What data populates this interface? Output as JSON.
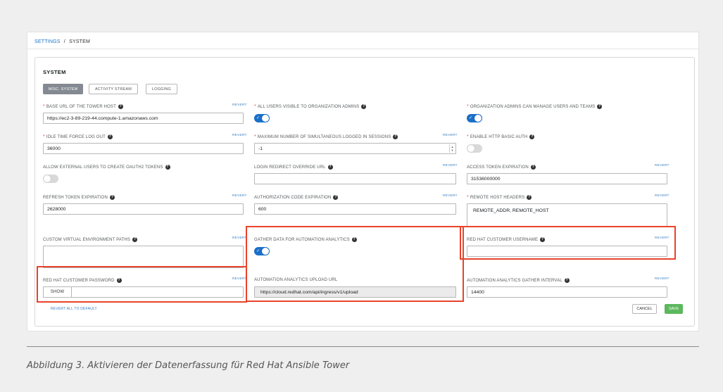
{
  "breadcrumb": {
    "parent": "SETTINGS",
    "separator": "/",
    "current": "SYSTEM"
  },
  "panel": {
    "title": "SYSTEM"
  },
  "tabs": [
    {
      "label": "MISC. SYSTEM",
      "active": true
    },
    {
      "label": "ACTIVITY STREAM",
      "active": false
    },
    {
      "label": "LOGGING",
      "active": false
    }
  ],
  "revert_label": "REVERT",
  "required_mark": "*",
  "help_glyph": "?",
  "fields": {
    "base_url": {
      "label": "BASE URL OF THE TOWER HOST",
      "value": "https://ec2-3-89-219-44.compute-1.amazonaws.com"
    },
    "users_visible": {
      "label": "ALL USERS VISIBLE TO ORGANIZATION ADMINS",
      "enabled": true
    },
    "org_admins_manage": {
      "label": "ORGANIZATION ADMINS CAN MANAGE USERS AND TEAMS",
      "enabled": true
    },
    "idle_logout": {
      "label": "IDLE TIME FORCE LOG OUT",
      "value": "36000"
    },
    "max_sessions": {
      "label": "MAXIMUM NUMBER OF SIMULTANEOUS LOGGED IN SESSIONS",
      "value": "-1"
    },
    "basic_auth": {
      "label": "ENABLE HTTP BASIC AUTH",
      "enabled": false
    },
    "oauth_tokens": {
      "label": "ALLOW EXTERNAL USERS TO CREATE OAUTH2 TOKENS",
      "enabled": false
    },
    "login_redirect": {
      "label": "LOGIN REDIRECT OVERRIDE URL",
      "value": ""
    },
    "access_token": {
      "label": "ACCESS TOKEN EXPIRATION",
      "value": "31536000000"
    },
    "refresh_token": {
      "label": "REFRESH TOKEN EXPIRATION",
      "value": "2628000"
    },
    "auth_code": {
      "label": "AUTHORIZATION CODE EXPIRATION",
      "value": "600"
    },
    "remote_host": {
      "label": "REMOTE HOST HEADERS",
      "value": "REMOTE_ADDR, REMOTE_HOST"
    },
    "venv_paths": {
      "label": "CUSTOM VIRTUAL ENVIRONMENT PATHS",
      "value": ""
    },
    "gather_data": {
      "label": "GATHER DATA FOR AUTOMATION ANALYTICS",
      "enabled": true
    },
    "rh_username": {
      "label": "RED HAT CUSTOMER USERNAME",
      "value": ""
    },
    "rh_password": {
      "label": "RED HAT CUSTOMER PASSWORD",
      "show_label": "SHOW",
      "value": ""
    },
    "upload_url": {
      "label": "AUTOMATION ANALYTICS UPLOAD URL",
      "value": "https://cloud.redhat.com/api/ingress/v1/upload"
    },
    "gather_interval": {
      "label": "AUTOMATION ANALYTICS GATHER INTERVAL",
      "value": "14400"
    }
  },
  "footer": {
    "revert_all": "REVERT ALL TO DEFAULT",
    "cancel": "CANCEL",
    "save": "SAVE"
  },
  "colors": {
    "highlight": "#e8432a",
    "toggle_on": "#1a6fc9",
    "save": "#5cb85c",
    "link": "#3a7fc1"
  },
  "caption": "Abbildung 3. Aktivieren der Datenerfassung für Red Hat Ansible Tower"
}
